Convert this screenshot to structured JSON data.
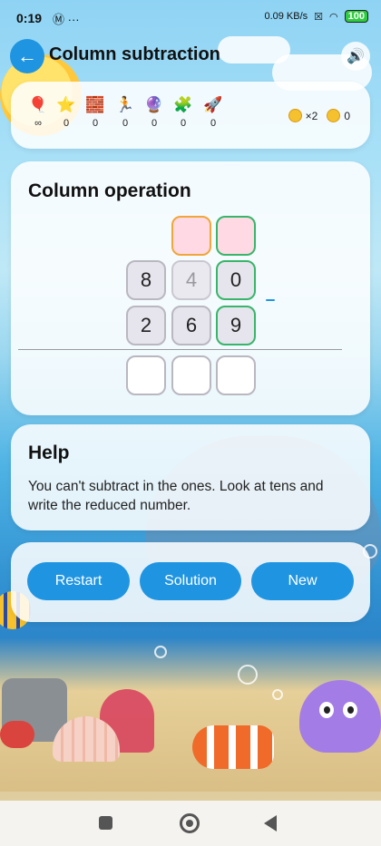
{
  "status_bar": {
    "time": "0:19",
    "left_icons": "Ⓜ ···",
    "network_speed": "0.09 KB/s",
    "battery": "100"
  },
  "header": {
    "title": "Column subtraction",
    "back_icon": "arrow-left-icon",
    "sound_icon": "speaker-icon"
  },
  "stats": {
    "items": [
      {
        "icon": "balloon-icon",
        "glyph": "🎈",
        "value": "∞"
      },
      {
        "icon": "star-icon",
        "glyph": "⭐",
        "value": "0"
      },
      {
        "icon": "brick-icon",
        "glyph": "🧱",
        "value": "0"
      },
      {
        "icon": "runner-icon",
        "glyph": "🏃",
        "value": "0"
      },
      {
        "icon": "crystal-ball-icon",
        "glyph": "🔮",
        "value": "0"
      },
      {
        "icon": "puzzle-icon",
        "glyph": "🧩",
        "value": "0"
      },
      {
        "icon": "rocket-icon",
        "glyph": "🚀",
        "value": "0"
      }
    ],
    "multiplier": "×2",
    "coins": "0"
  },
  "operation": {
    "title": "Column operation",
    "minuend": [
      "8",
      "4",
      "0"
    ],
    "subtrahend": [
      "2",
      "6",
      "9"
    ],
    "operator": "-"
  },
  "help": {
    "title": "Help",
    "text": "You can't subtract in the ones. Look at tens and write the reduced number."
  },
  "actions": {
    "restart": "Restart",
    "solution": "Solution",
    "new": "New"
  },
  "colors": {
    "accent": "#1f95e2",
    "highlight_green": "#38b56a",
    "highlight_orange": "#f0a63a",
    "borrow_cell": "#ffd9e3"
  }
}
